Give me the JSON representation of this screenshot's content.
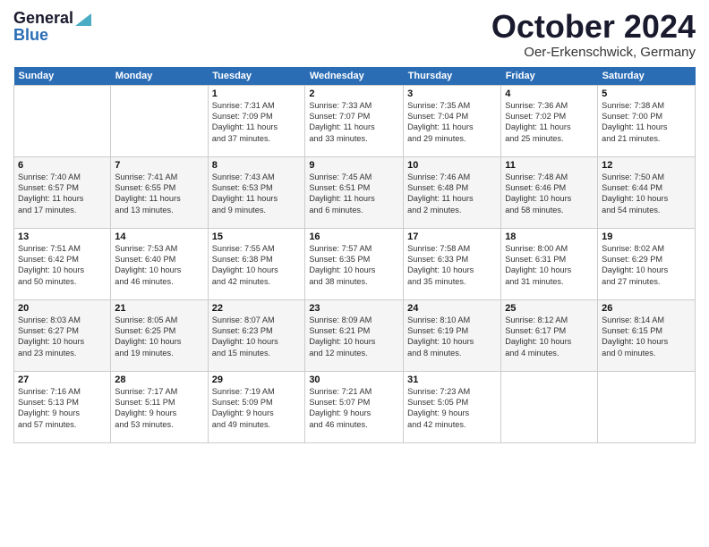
{
  "header": {
    "logo_line1": "General",
    "logo_line2": "Blue",
    "month_title": "October 2024",
    "location": "Oer-Erkenschwick, Germany"
  },
  "weekdays": [
    "Sunday",
    "Monday",
    "Tuesday",
    "Wednesday",
    "Thursday",
    "Friday",
    "Saturday"
  ],
  "weeks": [
    [
      {
        "day": "",
        "info": ""
      },
      {
        "day": "",
        "info": ""
      },
      {
        "day": "1",
        "info": "Sunrise: 7:31 AM\nSunset: 7:09 PM\nDaylight: 11 hours\nand 37 minutes."
      },
      {
        "day": "2",
        "info": "Sunrise: 7:33 AM\nSunset: 7:07 PM\nDaylight: 11 hours\nand 33 minutes."
      },
      {
        "day": "3",
        "info": "Sunrise: 7:35 AM\nSunset: 7:04 PM\nDaylight: 11 hours\nand 29 minutes."
      },
      {
        "day": "4",
        "info": "Sunrise: 7:36 AM\nSunset: 7:02 PM\nDaylight: 11 hours\nand 25 minutes."
      },
      {
        "day": "5",
        "info": "Sunrise: 7:38 AM\nSunset: 7:00 PM\nDaylight: 11 hours\nand 21 minutes."
      }
    ],
    [
      {
        "day": "6",
        "info": "Sunrise: 7:40 AM\nSunset: 6:57 PM\nDaylight: 11 hours\nand 17 minutes."
      },
      {
        "day": "7",
        "info": "Sunrise: 7:41 AM\nSunset: 6:55 PM\nDaylight: 11 hours\nand 13 minutes."
      },
      {
        "day": "8",
        "info": "Sunrise: 7:43 AM\nSunset: 6:53 PM\nDaylight: 11 hours\nand 9 minutes."
      },
      {
        "day": "9",
        "info": "Sunrise: 7:45 AM\nSunset: 6:51 PM\nDaylight: 11 hours\nand 6 minutes."
      },
      {
        "day": "10",
        "info": "Sunrise: 7:46 AM\nSunset: 6:48 PM\nDaylight: 11 hours\nand 2 minutes."
      },
      {
        "day": "11",
        "info": "Sunrise: 7:48 AM\nSunset: 6:46 PM\nDaylight: 10 hours\nand 58 minutes."
      },
      {
        "day": "12",
        "info": "Sunrise: 7:50 AM\nSunset: 6:44 PM\nDaylight: 10 hours\nand 54 minutes."
      }
    ],
    [
      {
        "day": "13",
        "info": "Sunrise: 7:51 AM\nSunset: 6:42 PM\nDaylight: 10 hours\nand 50 minutes."
      },
      {
        "day": "14",
        "info": "Sunrise: 7:53 AM\nSunset: 6:40 PM\nDaylight: 10 hours\nand 46 minutes."
      },
      {
        "day": "15",
        "info": "Sunrise: 7:55 AM\nSunset: 6:38 PM\nDaylight: 10 hours\nand 42 minutes."
      },
      {
        "day": "16",
        "info": "Sunrise: 7:57 AM\nSunset: 6:35 PM\nDaylight: 10 hours\nand 38 minutes."
      },
      {
        "day": "17",
        "info": "Sunrise: 7:58 AM\nSunset: 6:33 PM\nDaylight: 10 hours\nand 35 minutes."
      },
      {
        "day": "18",
        "info": "Sunrise: 8:00 AM\nSunset: 6:31 PM\nDaylight: 10 hours\nand 31 minutes."
      },
      {
        "day": "19",
        "info": "Sunrise: 8:02 AM\nSunset: 6:29 PM\nDaylight: 10 hours\nand 27 minutes."
      }
    ],
    [
      {
        "day": "20",
        "info": "Sunrise: 8:03 AM\nSunset: 6:27 PM\nDaylight: 10 hours\nand 23 minutes."
      },
      {
        "day": "21",
        "info": "Sunrise: 8:05 AM\nSunset: 6:25 PM\nDaylight: 10 hours\nand 19 minutes."
      },
      {
        "day": "22",
        "info": "Sunrise: 8:07 AM\nSunset: 6:23 PM\nDaylight: 10 hours\nand 15 minutes."
      },
      {
        "day": "23",
        "info": "Sunrise: 8:09 AM\nSunset: 6:21 PM\nDaylight: 10 hours\nand 12 minutes."
      },
      {
        "day": "24",
        "info": "Sunrise: 8:10 AM\nSunset: 6:19 PM\nDaylight: 10 hours\nand 8 minutes."
      },
      {
        "day": "25",
        "info": "Sunrise: 8:12 AM\nSunset: 6:17 PM\nDaylight: 10 hours\nand 4 minutes."
      },
      {
        "day": "26",
        "info": "Sunrise: 8:14 AM\nSunset: 6:15 PM\nDaylight: 10 hours\nand 0 minutes."
      }
    ],
    [
      {
        "day": "27",
        "info": "Sunrise: 7:16 AM\nSunset: 5:13 PM\nDaylight: 9 hours\nand 57 minutes."
      },
      {
        "day": "28",
        "info": "Sunrise: 7:17 AM\nSunset: 5:11 PM\nDaylight: 9 hours\nand 53 minutes."
      },
      {
        "day": "29",
        "info": "Sunrise: 7:19 AM\nSunset: 5:09 PM\nDaylight: 9 hours\nand 49 minutes."
      },
      {
        "day": "30",
        "info": "Sunrise: 7:21 AM\nSunset: 5:07 PM\nDaylight: 9 hours\nand 46 minutes."
      },
      {
        "day": "31",
        "info": "Sunrise: 7:23 AM\nSunset: 5:05 PM\nDaylight: 9 hours\nand 42 minutes."
      },
      {
        "day": "",
        "info": ""
      },
      {
        "day": "",
        "info": ""
      }
    ]
  ]
}
